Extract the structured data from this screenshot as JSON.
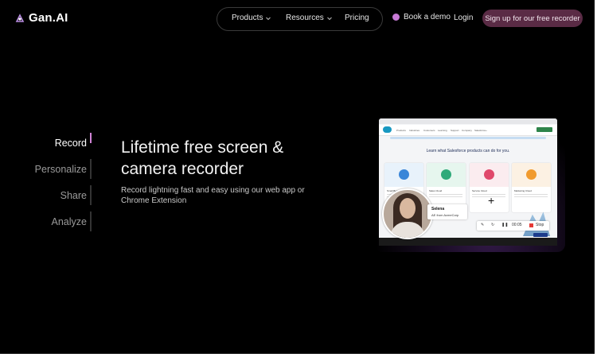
{
  "header": {
    "logo_text": "Gan.AI",
    "nav": [
      {
        "label": "Products"
      },
      {
        "label": "Resources"
      },
      {
        "label": "Pricing"
      }
    ],
    "book_demo": "Book a demo",
    "login": "Login",
    "signup": "Sign up for our free recorder"
  },
  "tabs": [
    {
      "label": "Record",
      "active": true
    },
    {
      "label": "Personalize",
      "active": false
    },
    {
      "label": "Share",
      "active": false
    },
    {
      "label": "Analyze",
      "active": false
    }
  ],
  "hero": {
    "headline": "Lifetime free screen & camera recorder",
    "subtext": "Record lightning fast and easy using our web app or Chrome Extension"
  },
  "preview": {
    "heading": "Learn what Salesforce products can do for you.",
    "nav_items": [
      "Products",
      "Industries",
      "Customers",
      "Learning",
      "Support",
      "Company",
      "Salesforce+"
    ],
    "cards": [
      {
        "title": "Small Business",
        "color": "#e8f2fb",
        "icon_color": "#3a86d8"
      },
      {
        "title": "Sales Cloud",
        "color": "#e6f6ee",
        "icon_color": "#2faa7a"
      },
      {
        "title": "Service Cloud",
        "color": "#fbecef",
        "icon_color": "#e0486b"
      },
      {
        "title": "Marketing Cloud",
        "color": "#fcf1e3",
        "icon_color": "#f19b2e"
      }
    ],
    "presenter_name": "Selena",
    "presenter_role": "AE from AcmeCorp",
    "timer": "00:05",
    "stop_label": "Stop"
  },
  "colors": {
    "accent": "#d084d6",
    "signup_bg": "#5a2b45",
    "background": "#000000"
  }
}
